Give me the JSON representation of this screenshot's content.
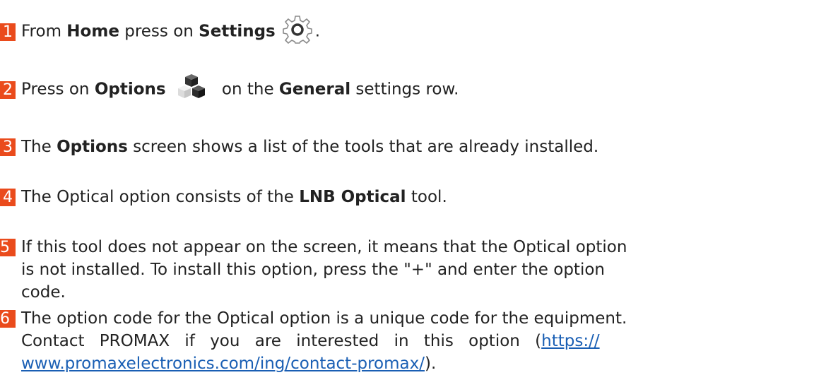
{
  "steps": [
    {
      "num": "1",
      "a": "From ",
      "b1": "Home",
      "c": " press on ",
      "b2": "Settings",
      "d": ".",
      "icon": "settings-gear-icon"
    },
    {
      "num": "2",
      "a": "Press on ",
      "b1": "Options",
      "c": " on the ",
      "b2": "General",
      "d": " settings row.",
      "icon": "options-cubes-icon"
    },
    {
      "num": "3",
      "a": "The ",
      "b1": "Options",
      "c": " screen shows a list of the tools that are already installed."
    },
    {
      "num": "4",
      "a": "The Optical option consists of the ",
      "b1": "LNB Optical",
      "c": " tool."
    },
    {
      "num": "5",
      "line1": "If this tool does not appear on the screen, it means that the Optical option",
      "line2": "is not installed. To install this option, press the \"+\" and enter the option",
      "line3": "code."
    },
    {
      "num": "6",
      "line1": "The option code for the Optical option is a unique code for the equipment.",
      "line2_text": "Contact PROMAX if you are interested in this option (",
      "line2_link": "https://",
      "line3_link": "www.promaxelectronics.com/ing/contact-promax/",
      "line3_tail": ")."
    }
  ],
  "colors": {
    "badge": "#ea4b1c",
    "link": "#1a5fb4"
  }
}
